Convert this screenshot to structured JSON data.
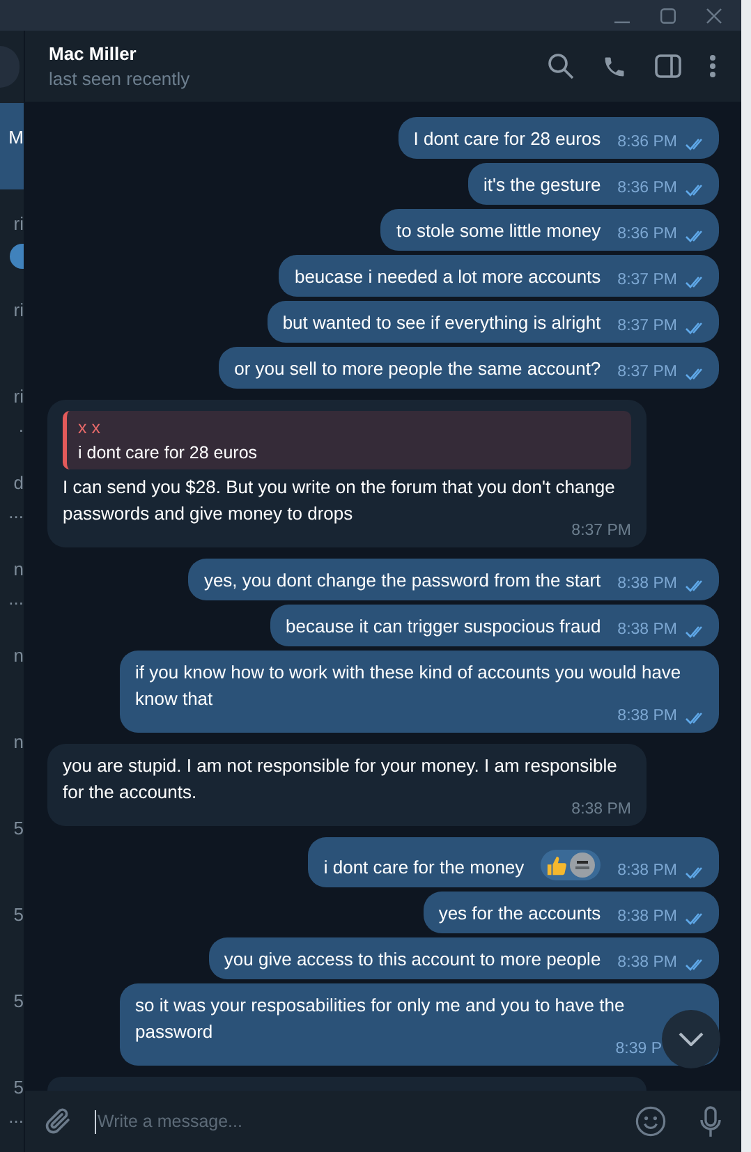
{
  "chat_list": [
    {
      "selected": true,
      "unread": false,
      "lines": [
        "M"
      ]
    },
    {
      "selected": false,
      "unread": true,
      "lines": [
        "ri"
      ]
    },
    {
      "selected": false,
      "unread": false,
      "lines": [
        "ri"
      ]
    },
    {
      "selected": false,
      "unread": false,
      "lines": [
        "ri",
        "."
      ]
    },
    {
      "selected": false,
      "unread": false,
      "lines": [
        "d",
        "..."
      ]
    },
    {
      "selected": false,
      "unread": false,
      "lines": [
        "n",
        "..."
      ]
    },
    {
      "selected": false,
      "unread": false,
      "lines": [
        "n"
      ]
    },
    {
      "selected": false,
      "unread": false,
      "lines": [
        "n"
      ]
    },
    {
      "selected": false,
      "unread": false,
      "lines": [
        "5"
      ]
    },
    {
      "selected": false,
      "unread": false,
      "lines": [
        "5"
      ]
    },
    {
      "selected": false,
      "unread": false,
      "lines": [
        "5"
      ]
    },
    {
      "selected": false,
      "unread": false,
      "lines": [
        "5",
        "..."
      ]
    }
  ],
  "header": {
    "name": "Mac Miller",
    "status": "last seen recently"
  },
  "messages": [
    {
      "outgoing": true,
      "text": "I dont care for 28 euros",
      "time": "8:36 PM",
      "read": true
    },
    {
      "outgoing": true,
      "text": "it's the gesture",
      "time": "8:36 PM",
      "read": true
    },
    {
      "outgoing": true,
      "text": "to stole some little money",
      "time": "8:36 PM",
      "read": true
    },
    {
      "outgoing": true,
      "text": "beucase i needed a lot more accounts",
      "time": "8:37 PM",
      "read": true
    },
    {
      "outgoing": true,
      "text": "but wanted to see if everything is alright",
      "time": "8:37 PM",
      "read": true
    },
    {
      "outgoing": true,
      "text": "or you sell to more people the same account?",
      "time": "8:37 PM",
      "read": true
    },
    {
      "outgoing": false,
      "reply": {
        "author": "x x",
        "text": "i dont care for 28 euros"
      },
      "text": "I can send you $28. But you write on the forum that you don't change passwords and give money to drops",
      "time": "8:37 PM"
    },
    {
      "outgoing": true,
      "text": "yes, you dont change the password from the start",
      "time": "8:38 PM",
      "read": true
    },
    {
      "outgoing": true,
      "text": "because it can trigger suspocious fraud",
      "time": "8:38 PM",
      "read": true
    },
    {
      "outgoing": true,
      "text": "if you know how to work with these kind of accounts you would have know that",
      "time": "8:38 PM",
      "read": true
    },
    {
      "outgoing": false,
      "text": "you are stupid. I am not responsible for your money. I am responsible for the accounts.",
      "time": "8:38 PM"
    },
    {
      "outgoing": true,
      "text": "i dont care for the money",
      "time": "8:38 PM",
      "read": true,
      "reactions": [
        {
          "kind": "thumbs"
        },
        {
          "kind": "avatar"
        }
      ]
    },
    {
      "outgoing": true,
      "text": "yes for the accounts",
      "time": "8:38 PM",
      "read": true
    },
    {
      "outgoing": true,
      "text": "you give access to this account to more people",
      "time": "8:38 PM",
      "read": true
    },
    {
      "outgoing": true,
      "text": "so it was your resposabilities for only me and you to have the password",
      "time": "8:39 P"
    }
  ],
  "composer": {
    "placeholder": "Write a message..."
  }
}
